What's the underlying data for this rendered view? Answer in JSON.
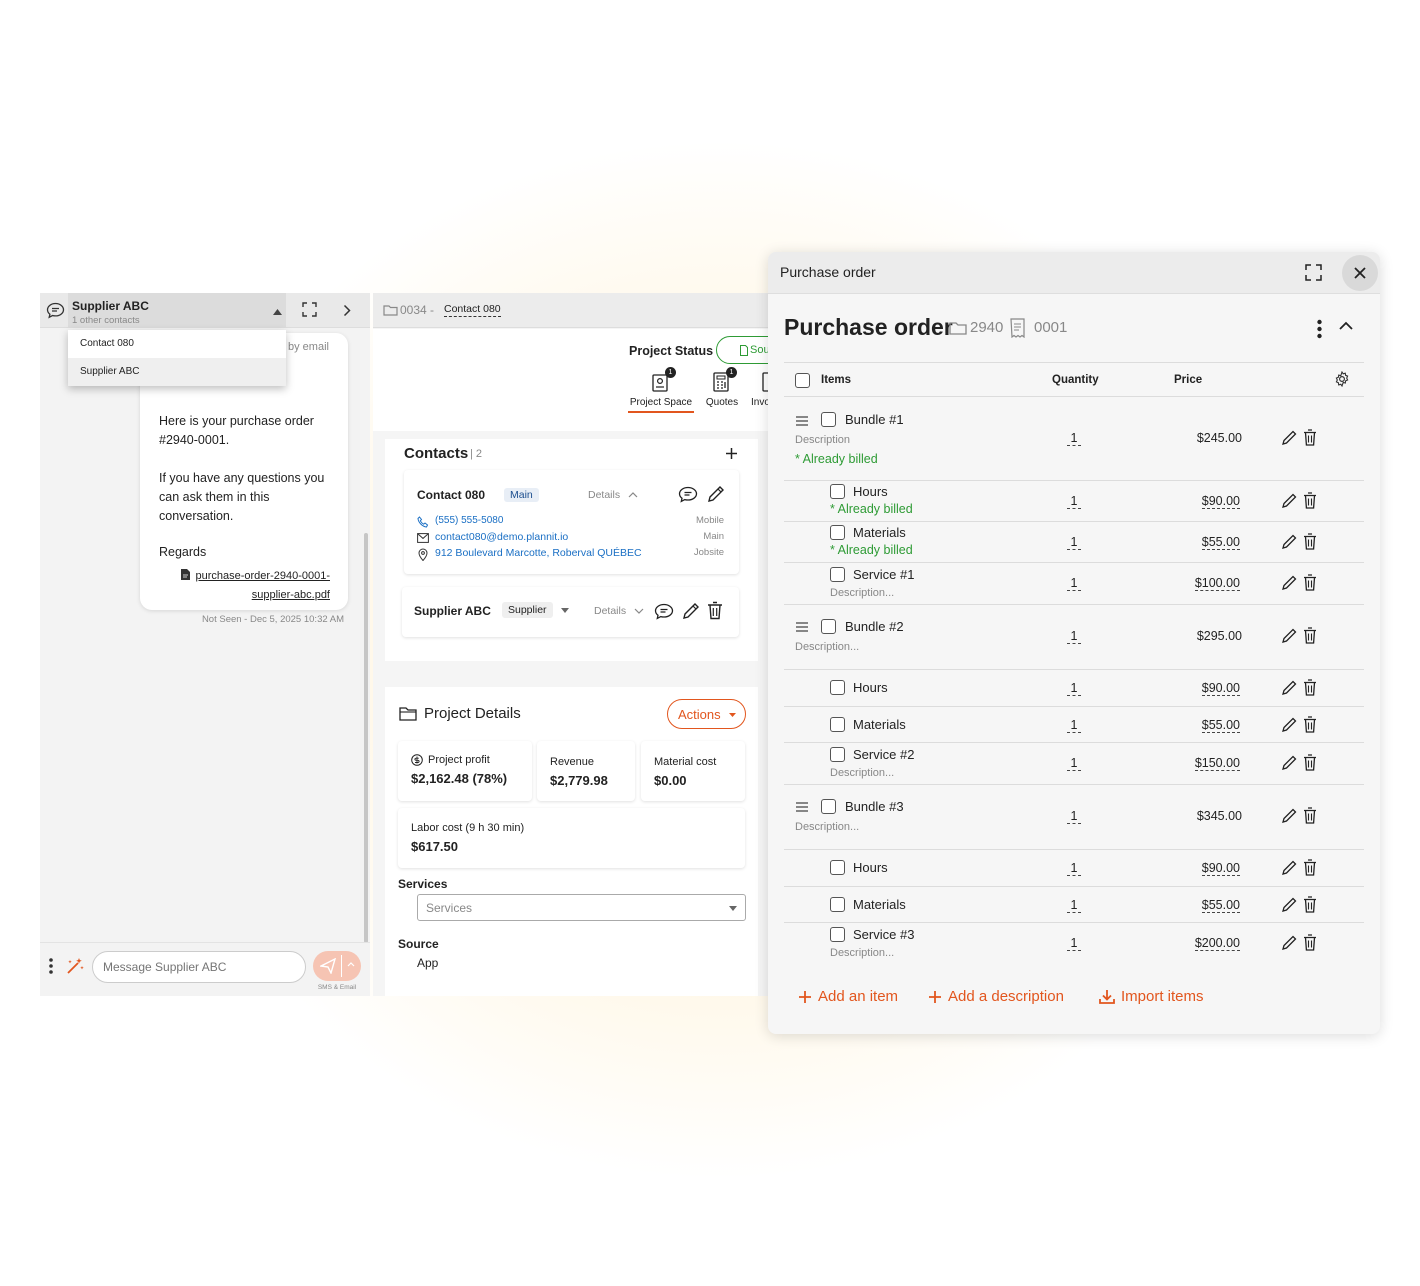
{
  "chat": {
    "header_name": "Supplier ABC",
    "header_sub": "1 other contacts",
    "dropdown_options": [
      "Contact 080",
      "Supplier ABC"
    ],
    "partial_text": "by email",
    "message_p1": "Here is your purchase order #2940-0001.",
    "message_p2": "If you have any questions you can ask them in this conversation.",
    "message_p3": "Regards",
    "attachment": "purchase-order-2940-0001-supplier-abc.pdf",
    "status": "Not Seen - Dec 5, 2025 10:32 AM",
    "input_placeholder": "Message Supplier ABC",
    "send_caption": "SMS & Email"
  },
  "project": {
    "breadcrumb_id": "0034 -",
    "breadcrumb_contact": "Contact 080",
    "status_label": "Project Status",
    "status_button": "Sou",
    "nav": [
      {
        "label": "Project Space",
        "badge": "1"
      },
      {
        "label": "Quotes",
        "badge": "1"
      },
      {
        "label": "Invo"
      }
    ],
    "contacts_title": "Contacts",
    "contacts_count": "| 2",
    "contact1": {
      "name": "Contact 080",
      "tag": "Main",
      "details": "Details",
      "phone": "(555) 555-5080",
      "phone_type": "Mobile",
      "email": "contact080@demo.plannit.io",
      "email_type": "Main",
      "address": "912 Boulevard Marcotte, Roberval QUÉBEC",
      "address_type": "Jobsite"
    },
    "contact2": {
      "name": "Supplier ABC",
      "tag": "Supplier",
      "details": "Details"
    },
    "details_title": "Project Details",
    "actions_button": "Actions",
    "profit_label": "Project profit",
    "profit_value": "$2,162.48 (78%)",
    "revenue_label": "Revenue",
    "revenue_value": "$2,779.98",
    "material_label": "Material cost",
    "material_value": "$0.00",
    "labor_label": "Labor cost (9 h 30 min)",
    "labor_value": "$617.50",
    "services_label": "Services",
    "services_placeholder": "Services",
    "source_label": "Source",
    "source_value": "App"
  },
  "po": {
    "window_title": "Purchase order",
    "title": "Purchase order",
    "project_num": "2940",
    "po_num": "0001",
    "col_items": "Items",
    "col_quantity": "Quantity",
    "col_price": "Price",
    "rows": [
      {
        "name": "Bundle #1",
        "desc": "Description",
        "billed": "* Already billed",
        "qty": "1",
        "price": "$245.00"
      },
      {
        "name": "Hours",
        "billed": "* Already billed",
        "qty": "1",
        "price": "$90.00"
      },
      {
        "name": "Materials",
        "billed": "* Already billed",
        "qty": "1",
        "price": "$55.00"
      },
      {
        "name": "Service #1",
        "desc": "Description...",
        "qty": "1",
        "price": "$100.00"
      },
      {
        "name": "Bundle #2",
        "desc": "Description...",
        "qty": "1",
        "price": "$295.00"
      },
      {
        "name": "Hours",
        "qty": "1",
        "price": "$90.00"
      },
      {
        "name": "Materials",
        "qty": "1",
        "price": "$55.00"
      },
      {
        "name": "Service #2",
        "desc": "Description...",
        "qty": "1",
        "price": "$150.00"
      },
      {
        "name": "Bundle #3",
        "desc": "Description...",
        "qty": "1",
        "price": "$345.00"
      },
      {
        "name": "Hours",
        "qty": "1",
        "price": "$90.00"
      },
      {
        "name": "Materials",
        "qty": "1",
        "price": "$55.00"
      },
      {
        "name": "Service #3",
        "desc": "Description...",
        "qty": "1",
        "price": "$200.00"
      }
    ],
    "add_item": "Add an item",
    "add_description": "Add a description",
    "import_items": "Import items"
  },
  "colors": {
    "accent": "#e2561e",
    "link": "#1a6fc4",
    "billed": "#2e9b35"
  }
}
